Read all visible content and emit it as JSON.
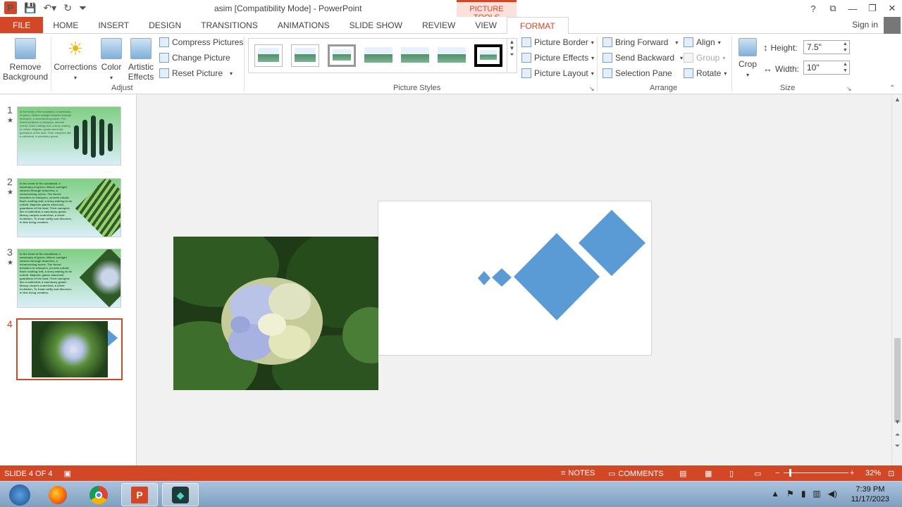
{
  "title_bar": {
    "app_icon": "P",
    "document_title": "asim [Compatibility Mode] - PowerPoint",
    "contextual_tab_group": "PICTURE TOOLS",
    "help_glyph": "?",
    "restore_glyph": "⧉",
    "minimize_glyph": "—",
    "maximize_glyph": "❐",
    "close_glyph": "✕"
  },
  "tabs": {
    "file": "FILE",
    "home": "HOME",
    "insert": "INSERT",
    "design": "DESIGN",
    "transitions": "TRANSITIONS",
    "animations": "ANIMATIONS",
    "slide_show": "SLIDE SHOW",
    "review": "REVIEW",
    "view": "VIEW",
    "format": "FORMAT",
    "sign_in": "Sign in"
  },
  "ribbon": {
    "adjust": {
      "remove_background": "Remove Background",
      "corrections": "Corrections",
      "color": "Color",
      "artistic_effects": "Artistic Effects",
      "compress_pictures": "Compress Pictures",
      "change_picture": "Change Picture",
      "reset_picture": "Reset Picture",
      "label": "Adjust"
    },
    "picture_styles": {
      "picture_border": "Picture Border",
      "picture_effects": "Picture Effects",
      "picture_layout": "Picture Layout",
      "label": "Picture Styles"
    },
    "arrange": {
      "bring_forward": "Bring Forward",
      "send_backward": "Send Backward",
      "selection_pane": "Selection Pane",
      "align": "Align",
      "group": "Group",
      "rotate": "Rotate",
      "label": "Arrange"
    },
    "size": {
      "crop": "Crop",
      "height_label": "Height:",
      "height_value": "7.5\"",
      "width_label": "Width:",
      "width_value": "10\"",
      "label": "Size"
    }
  },
  "slides": [
    {
      "number": "1",
      "star": "★",
      "text": "In the heart of the woodland, a sanctuary of green, Where sunlight weaves through branches, a mesmerizing scene. The forest breathes in whispers, secrets untold, Each rustling leaf, a story waiting to unfold. Majestic giants stand tall, guardians of the land, Their canopies like a cathedral, a sanctuary grand."
    },
    {
      "number": "2",
      "star": "★",
      "text": "In the heart of the woodland, a sanctuary of green, Where sunlight weaves through branches, a mesmerizing scene. The forest breathes in whispers, secrets untold, Each rustling leaf, a story waiting to be unfold. Majestic giants stand tall, guardians of the land, Their canopies like a cathedral, a sanctuary grand. Mossy carpets underfoot, a silent invitation, To tread softly and discover, in this living creation."
    },
    {
      "number": "3",
      "star": "★",
      "text": "In the heart of the woodland, a sanctuary of green, Where sunlight weaves through branches, a mesmerizing scene. The forest breathes in whispers, secrets untold, Each rustling leaf, a story waiting to be unfold. Majestic giants stand tall, guardians of the land, Their canopies like a cathedral, a sanctuary grand. Mossy carpets underfoot, a silent invitation, To tread softly and discover, in this living creation."
    },
    {
      "number": "4",
      "star": "",
      "text": ""
    }
  ],
  "status_bar": {
    "slide_indicator": "SLIDE 4 OF 4",
    "notes": "NOTES",
    "comments": "COMMENTS",
    "zoom": "32%",
    "zoom_minus": "−",
    "zoom_plus": "+"
  },
  "taskbar": {
    "time": "7:39 PM",
    "date": "11/17/2023"
  },
  "colors": {
    "accent": "#d24726",
    "diamond_blue": "#5b9bd5"
  }
}
